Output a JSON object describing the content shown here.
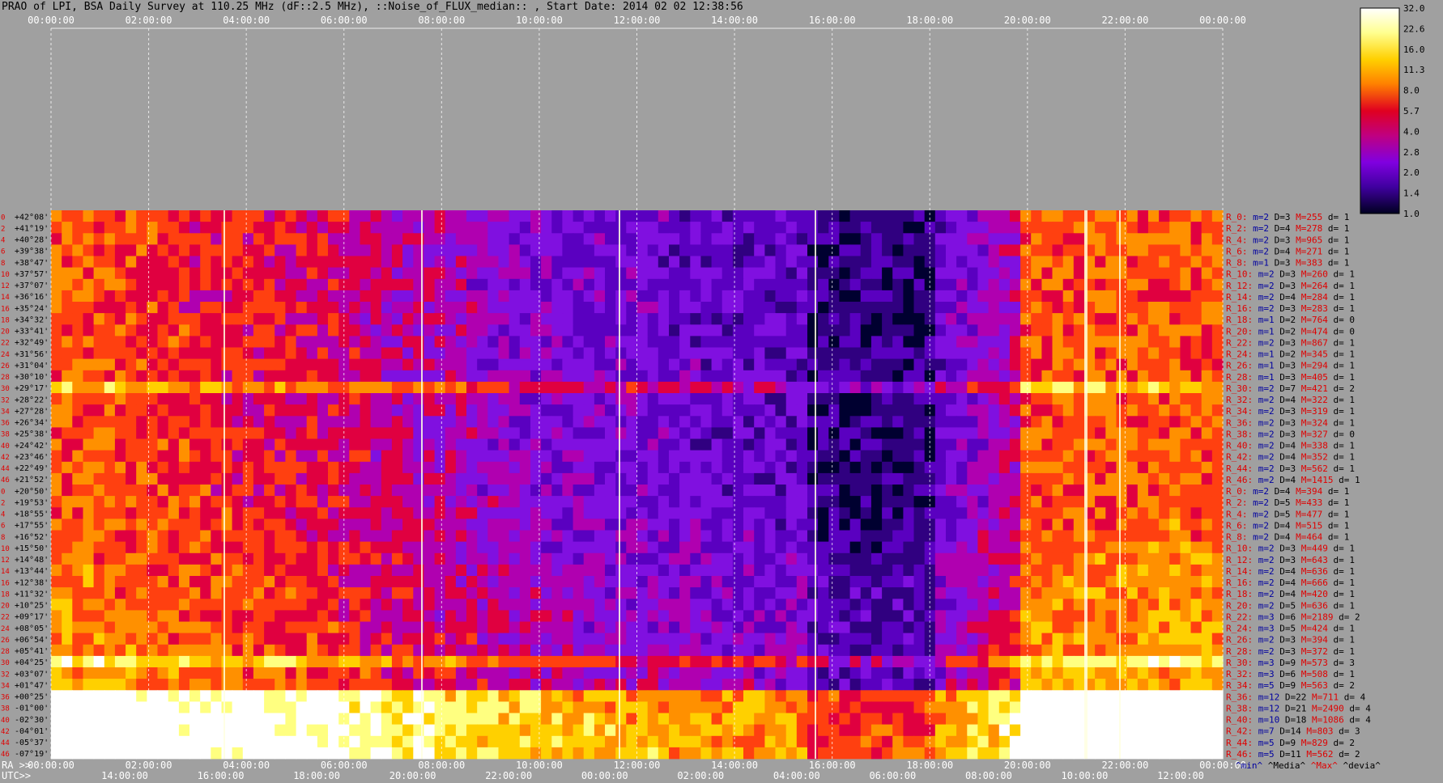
{
  "title": "PRAO of LPI, BSA Daily Survey at 110.25 MHz (dF::2.5 MHz), ::Noise_of_FLUX_median:: , Start Date: 2014 02 02 12:38:56",
  "colors": {
    "background": "#a0a0a0",
    "row_index": "#e00000",
    "stat_red": "#e00000",
    "stat_blue": "#0000a0",
    "stat_black": "#000000"
  },
  "chart_data": {
    "type": "heatmap",
    "top_axis_ticks": [
      "00:00:00",
      "02:00:00",
      "04:00:00",
      "06:00:00",
      "08:00:00",
      "10:00:00",
      "12:00:00",
      "14:00:00",
      "16:00:00",
      "18:00:00",
      "20:00:00",
      "22:00:00",
      "00:00:00"
    ],
    "bottom_ra_label": "RA >>",
    "bottom_ra_ticks": [
      "00:00:00",
      "02:00:00",
      "04:00:00",
      "06:00:00",
      "08:00:00",
      "10:00:00",
      "12:00:00",
      "14:00:00",
      "16:00:00",
      "18:00:00",
      "20:00:00",
      "22:00:00",
      "00:00:00"
    ],
    "bottom_utc_label": "UTC>>",
    "bottom_utc_ticks": [
      "14:00:00",
      "16:00:00",
      "18:00:00",
      "20:00:00",
      "22:00:00",
      "00:00:00",
      "02:00:00",
      "04:00:00",
      "06:00:00",
      "08:00:00",
      "10:00:00",
      "12:00:00"
    ],
    "colorbar": {
      "labels": [
        "32.0",
        "22.6",
        "16.0",
        "11.3",
        "8.0",
        "5.7",
        "4.0",
        "2.8",
        "2.0",
        "1.4",
        "1.0"
      ],
      "range": [
        1.0,
        32.0
      ],
      "scale": "log"
    },
    "rows": [
      {
        "i": "0",
        "dec": "+42°08'",
        "n": "R_0:",
        "m": "m=2",
        "D": "D=3",
        "M": "M=255",
        "d": "d= 1"
      },
      {
        "i": "2",
        "dec": "+41°19'",
        "n": "R_2:",
        "m": "m=2",
        "D": "D=4",
        "M": "M=278",
        "d": "d= 1"
      },
      {
        "i": "4",
        "dec": "+40°28'",
        "n": "R_4:",
        "m": "m=2",
        "D": "D=3",
        "M": "M=965",
        "d": "d= 1"
      },
      {
        "i": "6",
        "dec": "+39°38'",
        "n": "R_6:",
        "m": "m=2",
        "D": "D=4",
        "M": "M=271",
        "d": "d= 1"
      },
      {
        "i": "8",
        "dec": "+38°47'",
        "n": "R_8:",
        "m": "m=1",
        "D": "D=3",
        "M": "M=383",
        "d": "d= 1"
      },
      {
        "i": "10",
        "dec": "+37°57'",
        "n": "R_10:",
        "m": "m=2",
        "D": "D=3",
        "M": "M=260",
        "d": "d= 1"
      },
      {
        "i": "12",
        "dec": "+37°07'",
        "n": "R_12:",
        "m": "m=2",
        "D": "D=3",
        "M": "M=264",
        "d": "d= 1"
      },
      {
        "i": "14",
        "dec": "+36°16'",
        "n": "R_14:",
        "m": "m=2",
        "D": "D=4",
        "M": "M=284",
        "d": "d= 1"
      },
      {
        "i": "16",
        "dec": "+35°24'",
        "n": "R_16:",
        "m": "m=2",
        "D": "D=3",
        "M": "M=283",
        "d": "d= 1"
      },
      {
        "i": "18",
        "dec": "+34°32'",
        "n": "R_18:",
        "m": "m=1",
        "D": "D=2",
        "M": "M=764",
        "d": "d= 0"
      },
      {
        "i": "20",
        "dec": "+33°41'",
        "n": "R_20:",
        "m": "m=1",
        "D": "D=2",
        "M": "M=474",
        "d": "d= 0"
      },
      {
        "i": "22",
        "dec": "+32°49'",
        "n": "R_22:",
        "m": "m=2",
        "D": "D=3",
        "M": "M=867",
        "d": "d= 1"
      },
      {
        "i": "24",
        "dec": "+31°56'",
        "n": "R_24:",
        "m": "m=1",
        "D": "D=2",
        "M": "M=345",
        "d": "d= 1"
      },
      {
        "i": "26",
        "dec": "+31°04'",
        "n": "R_26:",
        "m": "m=1",
        "D": "D=3",
        "M": "M=294",
        "d": "d= 1"
      },
      {
        "i": "28",
        "dec": "+30°10'",
        "n": "R_28:",
        "m": "m=1",
        "D": "D=3",
        "M": "M=405",
        "d": "d= 1"
      },
      {
        "i": "30",
        "dec": "+29°17'",
        "n": "R_30:",
        "m": "m=2",
        "D": "D=7",
        "M": "M=421",
        "d": "d= 2"
      },
      {
        "i": "32",
        "dec": "+28°22'",
        "n": "R_32:",
        "m": "m=2",
        "D": "D=4",
        "M": "M=322",
        "d": "d= 1"
      },
      {
        "i": "34",
        "dec": "+27°28'",
        "n": "R_34:",
        "m": "m=2",
        "D": "D=3",
        "M": "M=319",
        "d": "d= 1"
      },
      {
        "i": "36",
        "dec": "+26°34'",
        "n": "R_36:",
        "m": "m=2",
        "D": "D=3",
        "M": "M=324",
        "d": "d= 1"
      },
      {
        "i": "38",
        "dec": "+25°38'",
        "n": "R_38:",
        "m": "m=2",
        "D": "D=3",
        "M": "M=327",
        "d": "d= 0"
      },
      {
        "i": "40",
        "dec": "+24°42'",
        "n": "R_40:",
        "m": "m=2",
        "D": "D=4",
        "M": "M=338",
        "d": "d= 1"
      },
      {
        "i": "42",
        "dec": "+23°46'",
        "n": "R_42:",
        "m": "m=2",
        "D": "D=4",
        "M": "M=352",
        "d": "d= 1"
      },
      {
        "i": "44",
        "dec": "+22°49'",
        "n": "R_44:",
        "m": "m=2",
        "D": "D=3",
        "M": "M=562",
        "d": "d= 1"
      },
      {
        "i": "46",
        "dec": "+21°52'",
        "n": "R_46:",
        "m": "m=2",
        "D": "D=4",
        "M": "M=1415",
        "d": "d= 1"
      },
      {
        "i": "0",
        "dec": "+20°50'",
        "n": "R_0:",
        "m": "m=2",
        "D": "D=4",
        "M": "M=394",
        "d": "d= 1"
      },
      {
        "i": "2",
        "dec": "+19°53'",
        "n": "R_2:",
        "m": "m=2",
        "D": "D=5",
        "M": "M=433",
        "d": "d= 1"
      },
      {
        "i": "4",
        "dec": "+18°55'",
        "n": "R_4:",
        "m": "m=2",
        "D": "D=5",
        "M": "M=477",
        "d": "d= 1"
      },
      {
        "i": "6",
        "dec": "+17°55'",
        "n": "R_6:",
        "m": "m=2",
        "D": "D=4",
        "M": "M=515",
        "d": "d= 1"
      },
      {
        "i": "8",
        "dec": "+16°52'",
        "n": "R_8:",
        "m": "m=2",
        "D": "D=4",
        "M": "M=464",
        "d": "d= 1"
      },
      {
        "i": "10",
        "dec": "+15°50'",
        "n": "R_10:",
        "m": "m=2",
        "D": "D=3",
        "M": "M=449",
        "d": "d= 1"
      },
      {
        "i": "12",
        "dec": "+14°48'",
        "n": "R_12:",
        "m": "m=2",
        "D": "D=3",
        "M": "M=643",
        "d": "d= 1"
      },
      {
        "i": "14",
        "dec": "+13°44'",
        "n": "R_14:",
        "m": "m=2",
        "D": "D=4",
        "M": "M=636",
        "d": "d= 1"
      },
      {
        "i": "16",
        "dec": "+12°38'",
        "n": "R_16:",
        "m": "m=2",
        "D": "D=4",
        "M": "M=666",
        "d": "d= 1"
      },
      {
        "i": "18",
        "dec": "+11°32'",
        "n": "R_18:",
        "m": "m=2",
        "D": "D=4",
        "M": "M=420",
        "d": "d= 1"
      },
      {
        "i": "20",
        "dec": "+10°25'",
        "n": "R_20:",
        "m": "m=2",
        "D": "D=5",
        "M": "M=636",
        "d": "d= 1"
      },
      {
        "i": "22",
        "dec": "+09°17'",
        "n": "R_22:",
        "m": "m=3",
        "D": "D=6",
        "M": "M=2189",
        "d": "d= 2"
      },
      {
        "i": "24",
        "dec": "+08°05'",
        "n": "R_24:",
        "m": "m=3",
        "D": "D=5",
        "M": "M=424",
        "d": "d= 1"
      },
      {
        "i": "26",
        "dec": "+06°54'",
        "n": "R_26:",
        "m": "m=2",
        "D": "D=3",
        "M": "M=394",
        "d": "d= 1"
      },
      {
        "i": "28",
        "dec": "+05°41'",
        "n": "R_28:",
        "m": "m=2",
        "D": "D=3",
        "M": "M=372",
        "d": "d= 1"
      },
      {
        "i": "30",
        "dec": "+04°25'",
        "n": "R_30:",
        "m": "m=3",
        "D": "D=9",
        "M": "M=573",
        "d": "d= 3"
      },
      {
        "i": "32",
        "dec": "+03°07'",
        "n": "R_32:",
        "m": "m=3",
        "D": "D=6",
        "M": "M=508",
        "d": "d= 1"
      },
      {
        "i": "34",
        "dec": "+01°47'",
        "n": "R_34:",
        "m": "m=5",
        "D": "D=9",
        "M": "M=563",
        "d": "d= 2"
      },
      {
        "i": "36",
        "dec": "+00°25'",
        "n": "R_36:",
        "m": "m=12",
        "D": "D=22",
        "M": "M=711",
        "d": "d= 4"
      },
      {
        "i": "38",
        "dec": "-01°00'",
        "n": "R_38:",
        "m": "m=12",
        "D": "D=21",
        "M": "M=2490",
        "d": "d= 4"
      },
      {
        "i": "40",
        "dec": "-02°30'",
        "n": "R_40:",
        "m": "m=10",
        "D": "D=18",
        "M": "M=1086",
        "d": "d= 4"
      },
      {
        "i": "42",
        "dec": "-04°01'",
        "n": "R_42:",
        "m": "m=7",
        "D": "D=14",
        "M": "M=803",
        "d": "d= 3"
      },
      {
        "i": "44",
        "dec": "-05°37'",
        "n": "R_44:",
        "m": "m=5",
        "D": "D=9",
        "M": "M=829",
        "d": "d= 2"
      },
      {
        "i": "46",
        "dec": "-07°19'",
        "n": "R_46:",
        "m": "m=5",
        "D": "D=11",
        "M": "M=562",
        "d": "d= 2"
      }
    ],
    "legend": [
      {
        "text": "^min^",
        "color": "#0000a0"
      },
      {
        "text": "^Media^",
        "color": "#000000"
      },
      {
        "text": "^Max^",
        "color": "#e00000"
      },
      {
        "text": "^devia^",
        "color": "#000000"
      }
    ]
  }
}
